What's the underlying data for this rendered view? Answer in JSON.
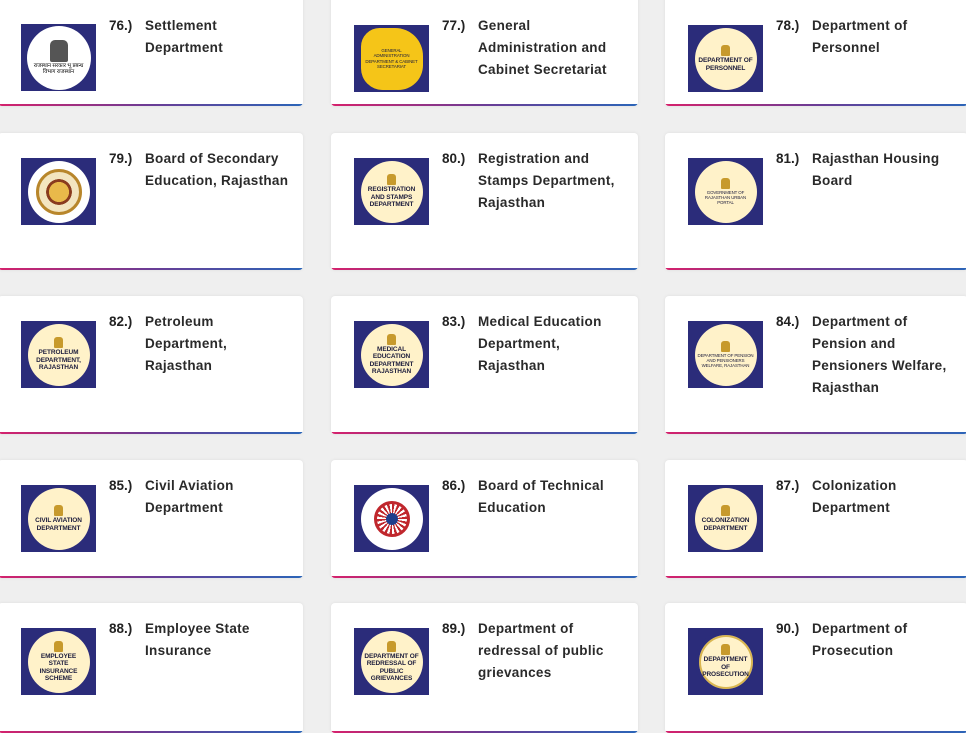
{
  "departments": [
    {
      "number": "76.)",
      "name": "Settlement Department",
      "logo": {
        "style": "emblem-white",
        "text": "राजस्थान सरकार\nभू प्रबन्ध विभाग राजस्थान"
      }
    },
    {
      "number": "77.)",
      "name": "General Administration and Cabinet Secretariat",
      "logo": {
        "style": "yellow-map",
        "text": "GENERAL ADMINISTRATION DEPARTMENT & CABINET SECRETARIAT"
      }
    },
    {
      "number": "78.)",
      "name": "Department of Personnel",
      "logo": {
        "style": "circle",
        "text": "DEPARTMENT OF PERSONNEL"
      }
    },
    {
      "number": "79.)",
      "name": "Board of Secondary Education, Rajasthan",
      "logo": {
        "style": "seal",
        "text": ""
      }
    },
    {
      "number": "80.)",
      "name": "Registration and Stamps Department, Rajasthan",
      "logo": {
        "style": "circle",
        "text": "REGISTRATION AND STAMPS DEPARTMENT"
      }
    },
    {
      "number": "81.)",
      "name": "Rajasthan Housing Board",
      "logo": {
        "style": "circle-tiny",
        "text": "GOVERNMENT OF RAJASTHAN URBAN PORTAL"
      }
    },
    {
      "number": "82.)",
      "name": "Petroleum Department, Rajasthan",
      "logo": {
        "style": "circle",
        "text": "PETROLEUM DEPARTMENT, RAJASTHAN"
      }
    },
    {
      "number": "83.)",
      "name": "Medical Education Department, Rajasthan",
      "logo": {
        "style": "circle",
        "text": "MEDICAL EDUCATION DEPARTMENT RAJASTHAN"
      }
    },
    {
      "number": "84.)",
      "name": "Department of Pension and Pensioners Welfare, Rajasthan",
      "logo": {
        "style": "circle-tiny",
        "text": "DEPARTMENT OF PENSION AND PENSIONERS WELFARE, RAJASTHAN"
      }
    },
    {
      "number": "85.)",
      "name": "Civil Aviation Department",
      "logo": {
        "style": "circle",
        "text": "CIVIL AVIATION DEPARTMENT"
      }
    },
    {
      "number": "86.)",
      "name": "Board of Technical Education",
      "logo": {
        "style": "wheel",
        "text": "TECHNICAL EDUCATION, RAJASTHAN JODHPUR"
      }
    },
    {
      "number": "87.)",
      "name": "Colonization Department",
      "logo": {
        "style": "circle",
        "text": "COLONIZATION DEPARTMENT"
      }
    },
    {
      "number": "88.)",
      "name": "Employee State Insurance",
      "logo": {
        "style": "circle",
        "text": "EMPLOYEE STATE INSURANCE SCHEME"
      }
    },
    {
      "number": "89.)",
      "name": "Department of redressal of public grievances",
      "logo": {
        "style": "circle",
        "text": "DEPARTMENT OF REDRESSAL OF PUBLIC GRIEVANCES"
      }
    },
    {
      "number": "90.)",
      "name": "Department of Prosecution",
      "logo": {
        "style": "circle-ring",
        "text": "DEPARTMENT OF PROSECUTION"
      }
    }
  ]
}
